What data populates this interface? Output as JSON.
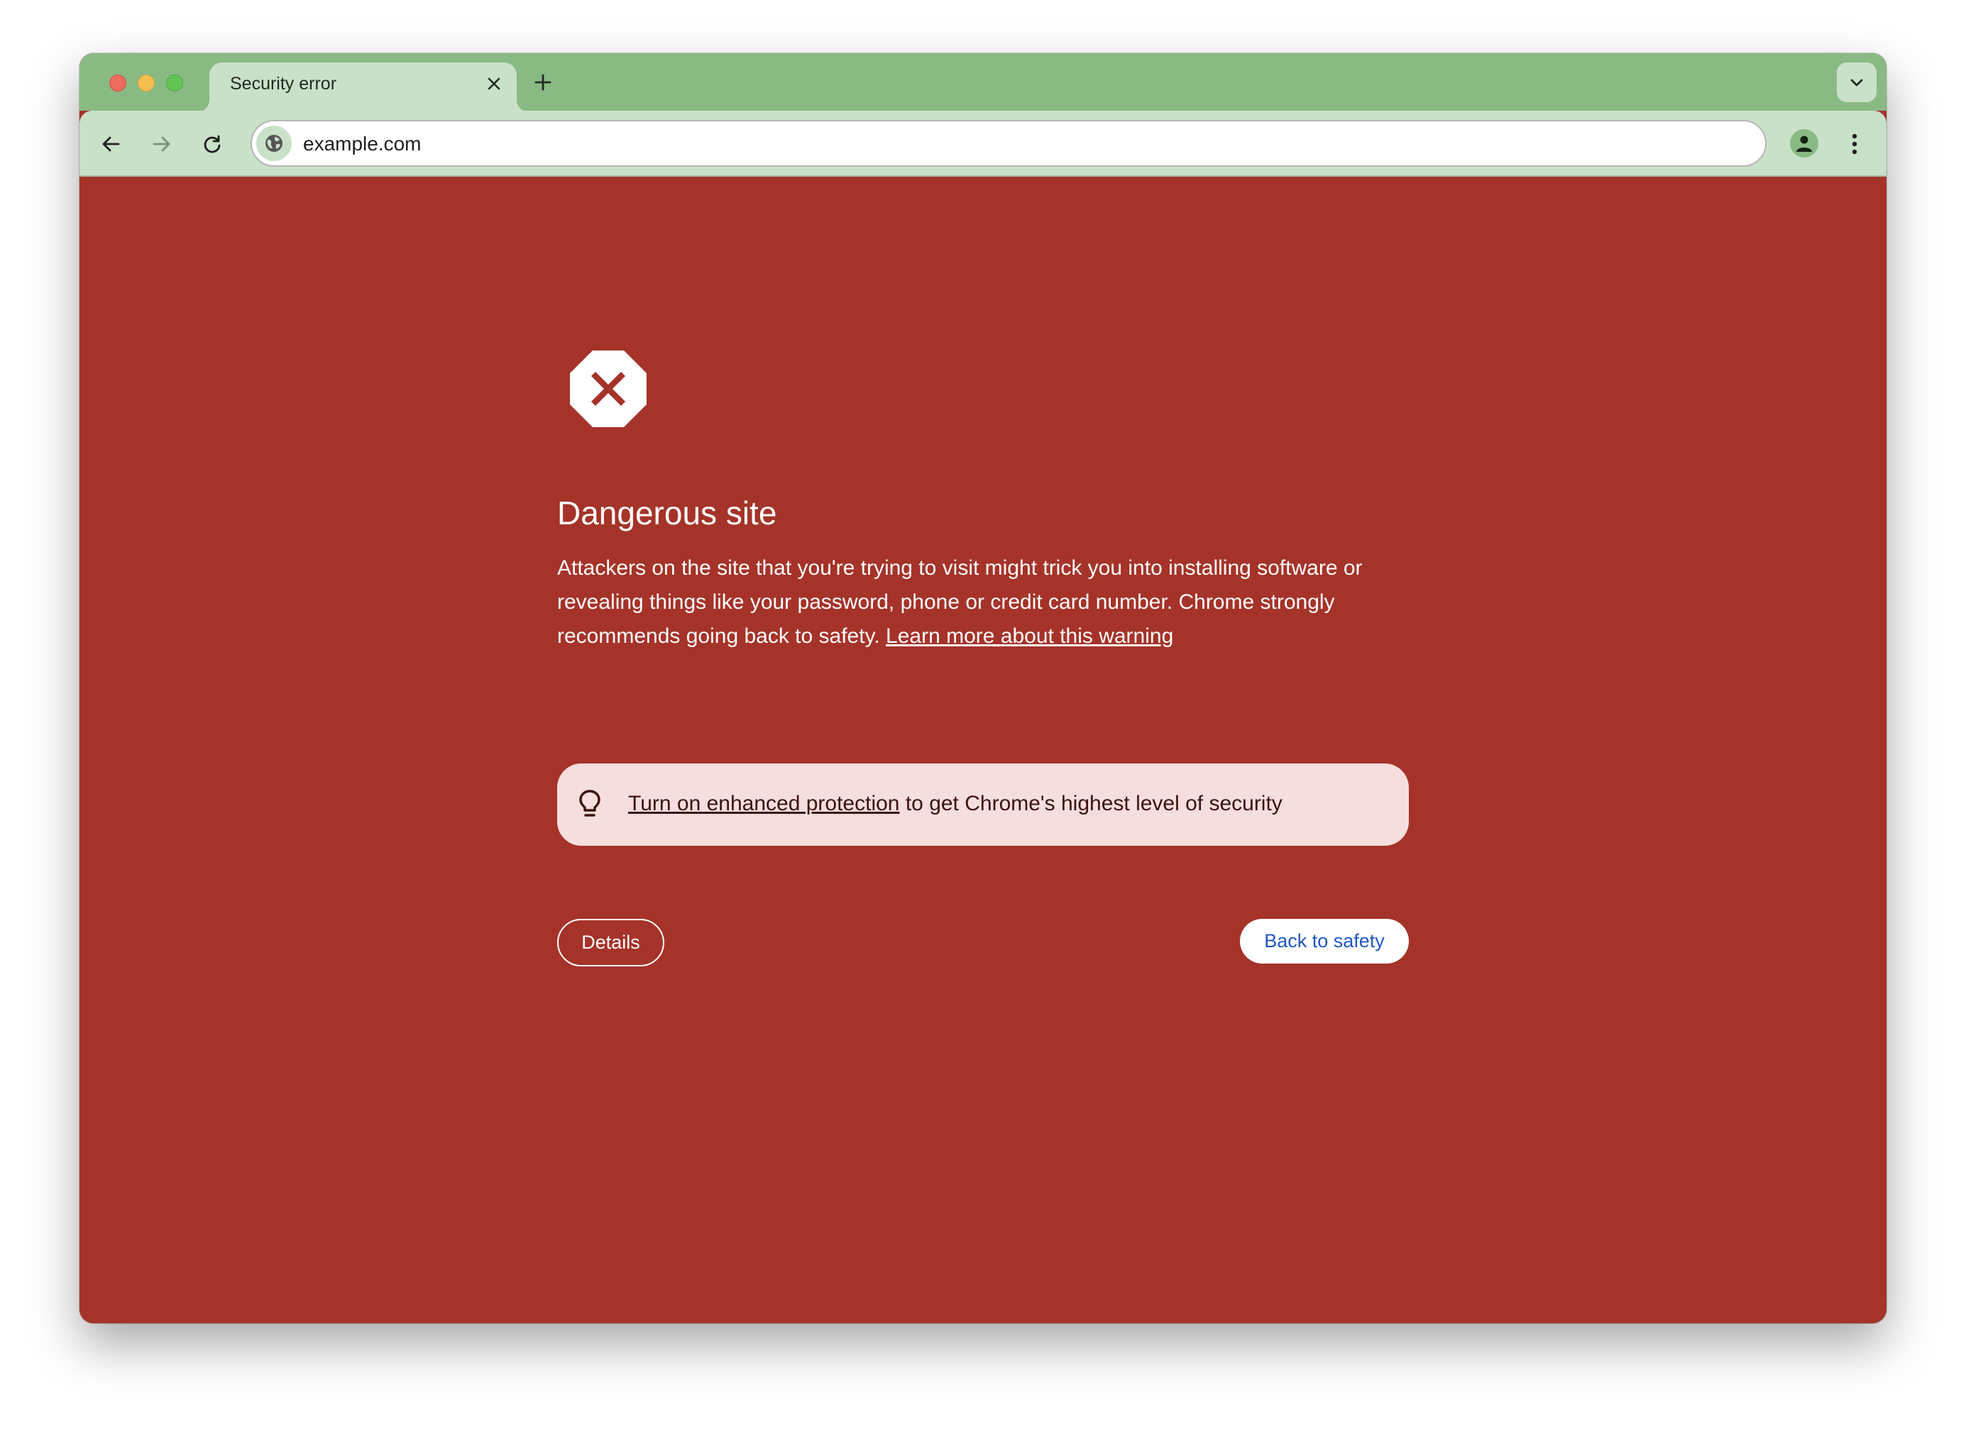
{
  "browser": {
    "tab": {
      "title": "Security error",
      "close_icon": "close-icon"
    },
    "new_tab_icon": "plus-icon",
    "tab_search_icon": "chevron-down-icon",
    "toolbar": {
      "back_icon": "arrow-left-icon",
      "forward_icon": "arrow-right-icon",
      "reload_icon": "reload-icon",
      "site_info_icon": "globe-icon",
      "url": "example.com",
      "profile_icon": "person-icon",
      "menu_icon": "more-vertical-icon"
    },
    "colors": {
      "tabstrip": "#8aba84",
      "toolbar": "#c9e1c8"
    }
  },
  "interstitial": {
    "icon": "stop-octagon-x-icon",
    "heading": "Dangerous site",
    "body_text": "Attackers on the site that you're trying to visit might trick you into installing software or revealing things like your password, phone or credit card number. Chrome strongly recommends going back to safety.",
    "learn_more_link": "Learn more about this warning",
    "banner": {
      "icon": "lightbulb-icon",
      "link_text": "Turn on enhanced protection",
      "trailing_text": " to get Chrome's highest level of security"
    },
    "details_button": "Details",
    "back_button": "Back to safety",
    "colors": {
      "background": "#a53329",
      "banner_bg": "#f5dedd",
      "banner_text": "#3a1210",
      "primary_button_text": "#1f56c4"
    }
  }
}
